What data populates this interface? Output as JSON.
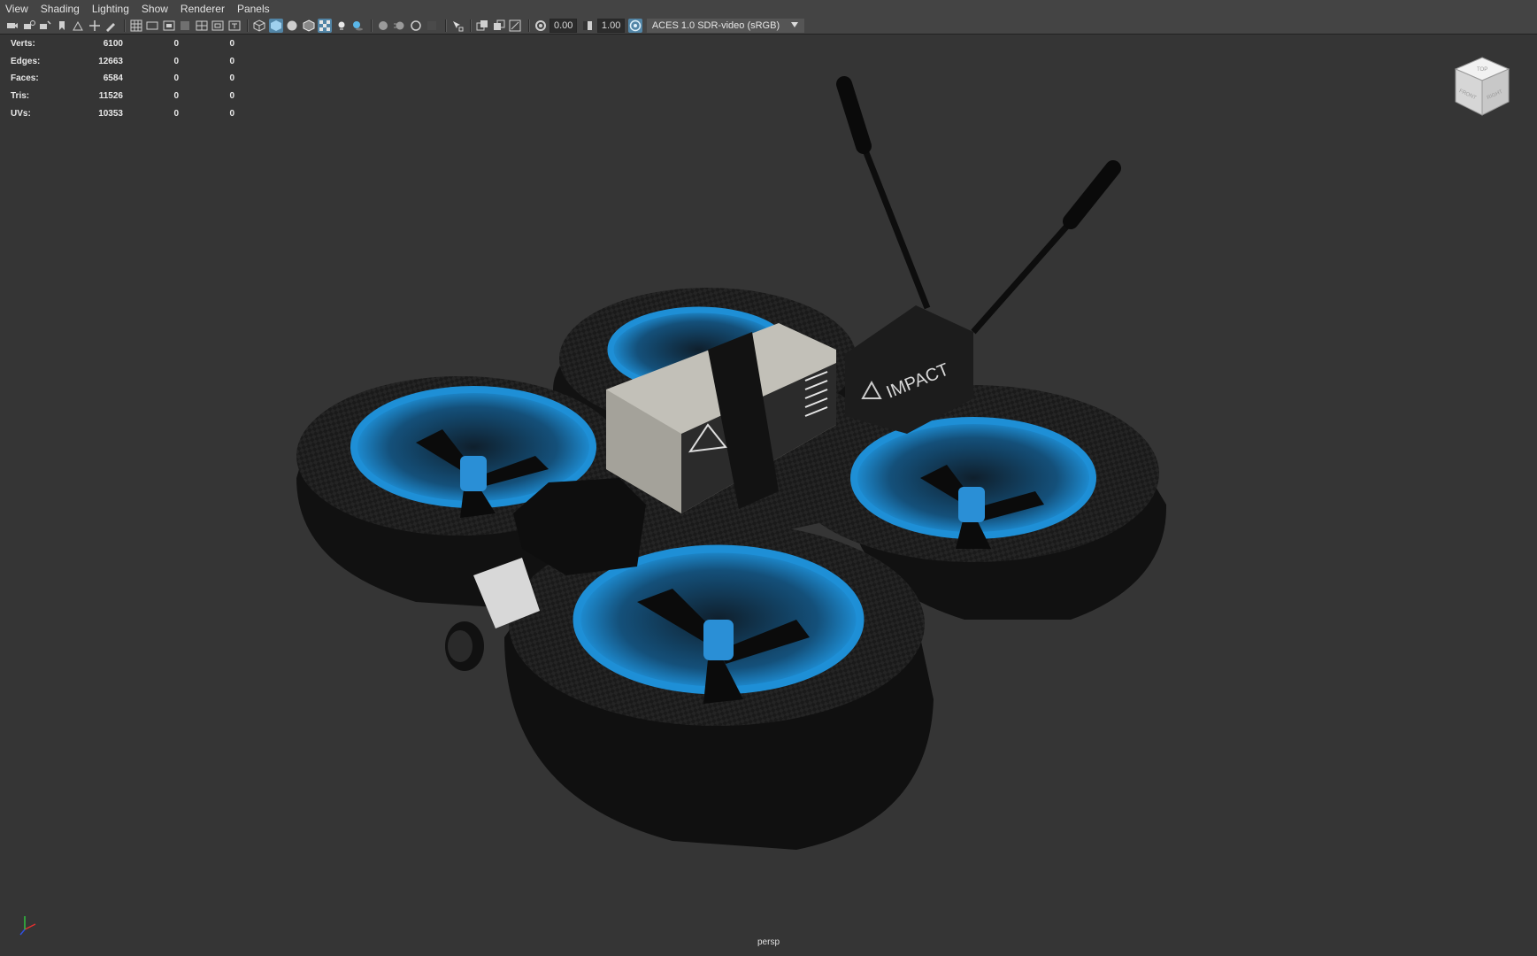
{
  "menu": {
    "items": [
      "View",
      "Shading",
      "Lighting",
      "Show",
      "Renderer",
      "Panels"
    ]
  },
  "toolbar": {
    "exposure_value": "0.00",
    "gamma_value": "1.00",
    "color_management": "ACES 1.0 SDR-video (sRGB)"
  },
  "hud": {
    "rows": [
      {
        "label": "Verts:",
        "value": "6100",
        "sel1": "0",
        "sel2": "0"
      },
      {
        "label": "Edges:",
        "value": "12663",
        "sel1": "0",
        "sel2": "0"
      },
      {
        "label": "Faces:",
        "value": "6584",
        "sel1": "0",
        "sel2": "0"
      },
      {
        "label": "Tris:",
        "value": "11526",
        "sel1": "0",
        "sel2": "0"
      },
      {
        "label": "UVs:",
        "value": "10353",
        "sel1": "0",
        "sel2": "0"
      }
    ]
  },
  "viewport": {
    "camera_label": "persp",
    "model_branding": "IMPACT",
    "viewcube_faces": [
      "TOP",
      "FRONT",
      "RIGHT"
    ]
  },
  "colors": {
    "accent": "#5285a6",
    "ring_blue": "#1e8fd6",
    "background": "#353535"
  }
}
